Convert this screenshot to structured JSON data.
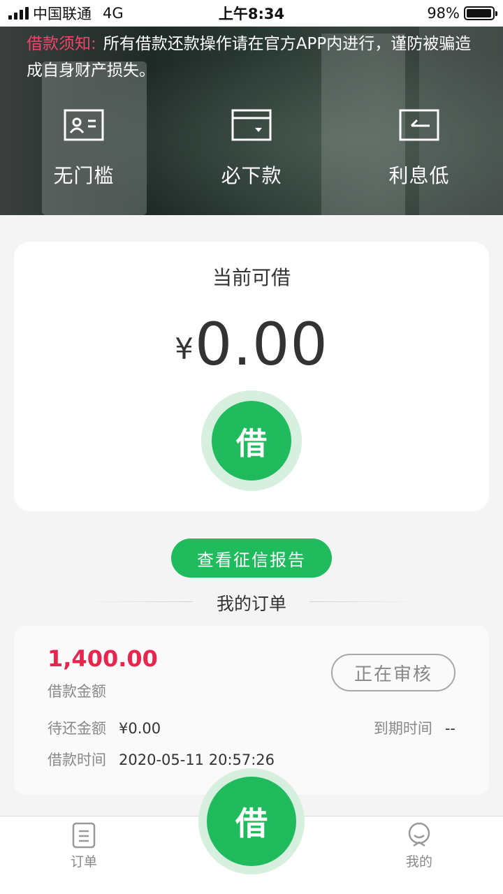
{
  "status_bar": {
    "carrier": "中国联通",
    "network": "4G",
    "time": "上午8:34",
    "battery": "98%",
    "battery_level": 0.98
  },
  "notice": {
    "label": "借款须知:",
    "text": "所有借款还款操作请在官方APP内进行，谨防被骗造成自身财产损失。"
  },
  "features": [
    {
      "icon": "id-card-icon",
      "label": "无门槛"
    },
    {
      "icon": "wallet-icon",
      "label": "必下款"
    },
    {
      "icon": "return-arrow-icon",
      "label": "利息低"
    }
  ],
  "loan": {
    "title": "当前可借",
    "currency": "¥",
    "amount": "0.00",
    "button": "借"
  },
  "credit_report_button": "查看征信报告",
  "orders": {
    "title": "我的订单",
    "items": [
      {
        "amount": "1,400.00",
        "amount_label": "借款金额",
        "status": "正在审核",
        "repay_label": "待还金额",
        "repay_value": "¥0.00",
        "due_label": "到期时间",
        "due_value": "--",
        "time_label": "借款时间",
        "time_value": "2020-05-11 20:57:26"
      }
    ]
  },
  "tabbar": {
    "orders": "订单",
    "center": "借",
    "mine": "我的"
  },
  "colors": {
    "accent": "#1fbb5c",
    "accent_light": "#d6efdf",
    "alert": "#e8244f"
  }
}
